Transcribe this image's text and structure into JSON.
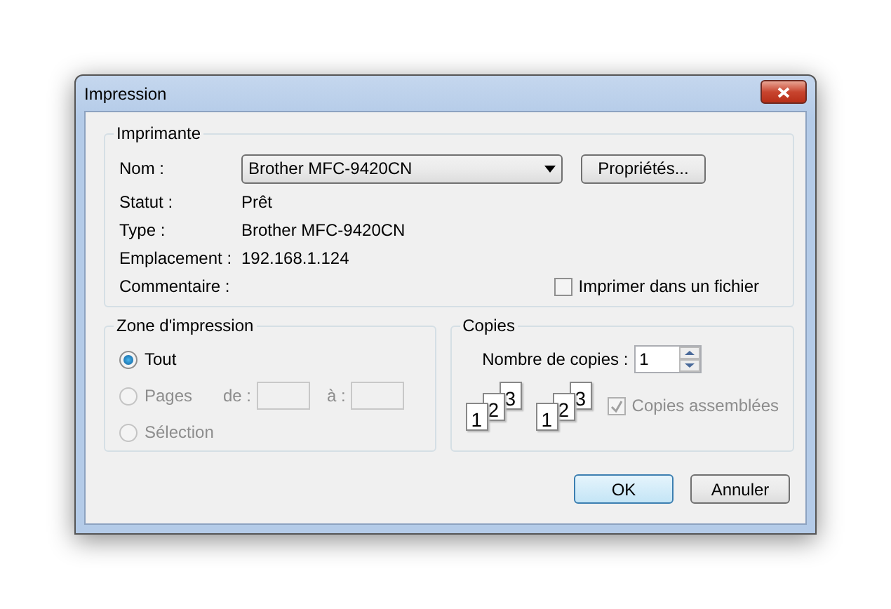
{
  "window": {
    "title": "Impression"
  },
  "printer": {
    "legend": "Imprimante",
    "name_label": "Nom :",
    "name_value": "Brother MFC-9420CN",
    "properties_button": "Propriétés...",
    "info": [
      {
        "label": "Statut :",
        "value": "Prêt"
      },
      {
        "label": "Type :",
        "value": "Brother MFC-9420CN"
      },
      {
        "label": "Emplacement :",
        "value": "192.168.1.124"
      },
      {
        "label": "Commentaire :"
      }
    ],
    "print_to_file": {
      "label": "Imprimer dans un fichier",
      "checked": false
    }
  },
  "range": {
    "legend": "Zone d'impression",
    "options": [
      {
        "label": "Tout",
        "selected": true,
        "disabled": false
      },
      {
        "label": "Pages",
        "selected": false,
        "disabled": true
      },
      {
        "label": "Sélection",
        "selected": false,
        "disabled": true
      }
    ],
    "from_label": "de :",
    "to_label": "à :"
  },
  "copies": {
    "legend": "Copies",
    "count_label": "Nombre de copies :",
    "count": "1",
    "stacks": [
      [
        "1",
        "2",
        "3"
      ],
      [
        "1",
        "2",
        "3"
      ]
    ],
    "collate": {
      "label": "Copies assemblées",
      "checked": true,
      "disabled": true
    }
  },
  "buttons": [
    {
      "label": "OK",
      "default": true
    },
    {
      "label": "Annuler",
      "default": false
    }
  ]
}
